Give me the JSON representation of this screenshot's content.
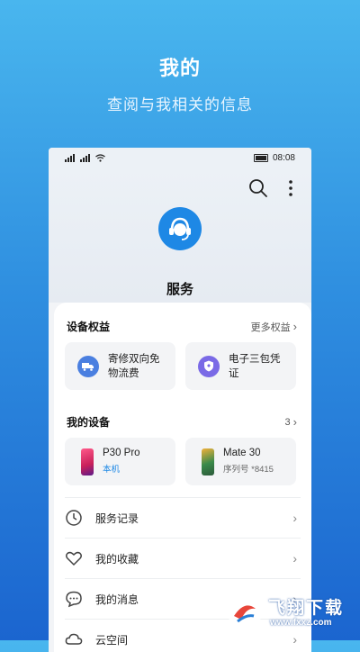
{
  "promo": {
    "title": "我的",
    "subtitle": "查阅与我相关的信息"
  },
  "status_bar": {
    "time": "08:08"
  },
  "header": {
    "title": "服务",
    "icons": [
      "search-icon",
      "more-icon"
    ]
  },
  "benefits": {
    "title": "设备权益",
    "more_label": "更多权益",
    "items": [
      {
        "label_line1": "寄修双向免",
        "label_line2": "物流费",
        "icon": "truck-icon"
      },
      {
        "label_line1": "电子三包凭",
        "label_line2": "证",
        "icon": "shield-icon"
      }
    ]
  },
  "devices": {
    "title": "我的设备",
    "count": "3",
    "items": [
      {
        "name": "P30 Pro",
        "sub": "本机",
        "sub_color": "#1e88e5"
      },
      {
        "name": "Mate 30",
        "sub": "序列号 *8415",
        "sub_color": "#666666"
      }
    ]
  },
  "menu": [
    {
      "label": "服务记录",
      "icon": "clock-icon"
    },
    {
      "label": "我的收藏",
      "icon": "heart-icon"
    },
    {
      "label": "我的消息",
      "icon": "chat-icon"
    },
    {
      "label": "云空间",
      "icon": "cloud-icon"
    }
  ],
  "watermark": {
    "text": "飞翔下载",
    "url": "www.fxxz.com"
  },
  "colors": {
    "accent": "#1e88e5",
    "background_top": "#49b6ee",
    "background_bottom": "#1b65cf"
  }
}
